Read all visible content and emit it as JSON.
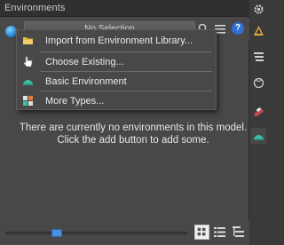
{
  "window": {
    "title": "Environments"
  },
  "toolbar": {
    "selector_value": "No Selection",
    "help_label": "?"
  },
  "menu": {
    "items": [
      {
        "label": "Import from Environment Library...",
        "icon": "folder-icon"
      },
      {
        "label": "Choose Existing...",
        "icon": "pointer-hand-icon"
      },
      {
        "label": "Basic Environment",
        "icon": "environment-icon"
      },
      {
        "label": "More Types...",
        "icon": "grid-types-icon"
      }
    ]
  },
  "empty_message": "There are currently no environments in this model. Click the add button to add some.",
  "bottombar": {
    "zoom_slider_fraction": 0.27
  },
  "sidebar": {
    "icons": [
      "gear-icon",
      "materials-icon",
      "layers-icon",
      "globe-outline-icon",
      "styles-icon",
      "environment-icon"
    ]
  },
  "colors": {
    "accent": "#4a90e2",
    "panel": "#484848",
    "titlebar": "#303030"
  }
}
